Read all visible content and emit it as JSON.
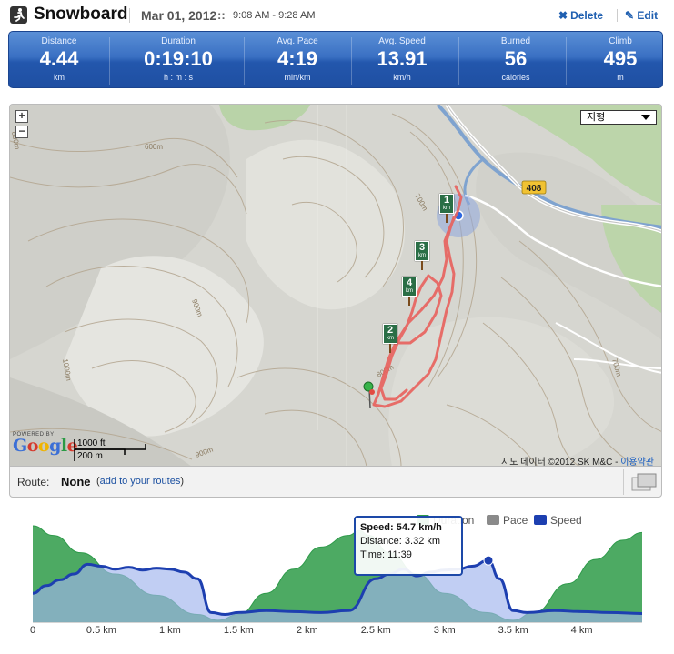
{
  "header": {
    "title": "Snowboard",
    "date": "Mar 01, 2012",
    "date_separator": "::",
    "time_range": "9:08 AM - 9:28 AM",
    "delete_label": "Delete",
    "edit_label": "Edit"
  },
  "stats": [
    {
      "label": "Distance",
      "value": "4.44",
      "unit": "km"
    },
    {
      "label": "Duration",
      "value": "0:19:10",
      "unit": "h : m : s"
    },
    {
      "label": "Avg. Pace",
      "value": "4:19",
      "unit": "min/km"
    },
    {
      "label": "Avg. Speed",
      "value": "13.91",
      "unit": "km/h"
    },
    {
      "label": "Burned",
      "value": "56",
      "unit": "calories"
    },
    {
      "label": "Climb",
      "value": "495",
      "unit": "m"
    }
  ],
  "map": {
    "zoom_in": "+",
    "zoom_out": "−",
    "map_type": "지형",
    "powered_by": "POWERED BY",
    "logo": "Google",
    "scale_ft": "1000 ft",
    "scale_m": "200 m",
    "copyright": "지도 데이터 ©2012 SK M&C -",
    "terms": "이용약관",
    "road_number": "408",
    "contours": [
      "600m",
      "700m",
      "800m",
      "900m",
      "1000m",
      "900m",
      "800m",
      "700m"
    ],
    "km_markers": [
      {
        "num": "1",
        "unit": "km"
      },
      {
        "num": "2",
        "unit": "km"
      },
      {
        "num": "3",
        "unit": "km"
      },
      {
        "num": "4",
        "unit": "km"
      }
    ],
    "route_color": "#e8605c"
  },
  "route": {
    "label": "Route:",
    "value": "None",
    "link_open": "(",
    "link": "add to your routes",
    "link_close": ")"
  },
  "chart": {
    "legend": [
      {
        "name": "Duration",
        "color": "#2e9a4a"
      },
      {
        "name": "Pace",
        "color": "#8a8a8a"
      },
      {
        "name": "Speed",
        "color": "#1d3fb0"
      }
    ],
    "tooltip": {
      "speed_label": "Speed:",
      "speed_value": "54.7 km/h",
      "distance_label": "Distance:",
      "distance_value": "3.32 km",
      "time_label": "Time:",
      "time_value": "11:39"
    }
  },
  "chart_data": {
    "type": "area",
    "x_ticks": [
      "0",
      "0.5 km",
      "1 km",
      "1.5 km",
      "2 km",
      "2.5 km",
      "3 km",
      "3.5 km",
      "4 km"
    ],
    "x_tick_values": [
      0,
      0.5,
      1,
      1.5,
      2,
      2.5,
      3,
      3.5,
      4
    ],
    "xlim": [
      0,
      4.44
    ],
    "series": [
      {
        "name": "Duration",
        "color": "#2e9a4a",
        "x": [
          0,
          0.15,
          0.35,
          0.6,
          0.9,
          1.2,
          1.35,
          1.5,
          1.7,
          1.9,
          2.1,
          2.3,
          2.38,
          2.45,
          2.6,
          2.8,
          3.0,
          3.3,
          3.5,
          3.65,
          3.9,
          4.1,
          4.3,
          4.44
        ],
        "values": [
          1.0,
          0.9,
          0.72,
          0.5,
          0.28,
          0.08,
          0.02,
          0.08,
          0.3,
          0.55,
          0.78,
          0.9,
          0.95,
          0.9,
          0.72,
          0.5,
          0.3,
          0.1,
          0.02,
          0.1,
          0.4,
          0.65,
          0.85,
          0.93
        ]
      },
      {
        "name": "Speed",
        "color": "#1d3fb0",
        "x": [
          0,
          0.1,
          0.2,
          0.3,
          0.4,
          0.5,
          0.6,
          0.7,
          0.8,
          0.9,
          1.0,
          1.1,
          1.2,
          1.3,
          1.4,
          1.5,
          1.7,
          1.9,
          2.1,
          2.3,
          2.5,
          2.6,
          2.7,
          2.8,
          2.9,
          3.0,
          3.1,
          3.2,
          3.32,
          3.4,
          3.5,
          3.6,
          3.8,
          4.0,
          4.2,
          4.44
        ],
        "values": [
          0.3,
          0.38,
          0.44,
          0.5,
          0.6,
          0.58,
          0.55,
          0.57,
          0.54,
          0.56,
          0.55,
          0.52,
          0.45,
          0.1,
          0.08,
          0.1,
          0.12,
          0.11,
          0.1,
          0.12,
          0.45,
          0.5,
          0.55,
          0.48,
          0.52,
          0.54,
          0.55,
          0.58,
          0.64,
          0.45,
          0.12,
          0.1,
          0.12,
          0.11,
          0.1,
          0.09
        ]
      }
    ]
  }
}
